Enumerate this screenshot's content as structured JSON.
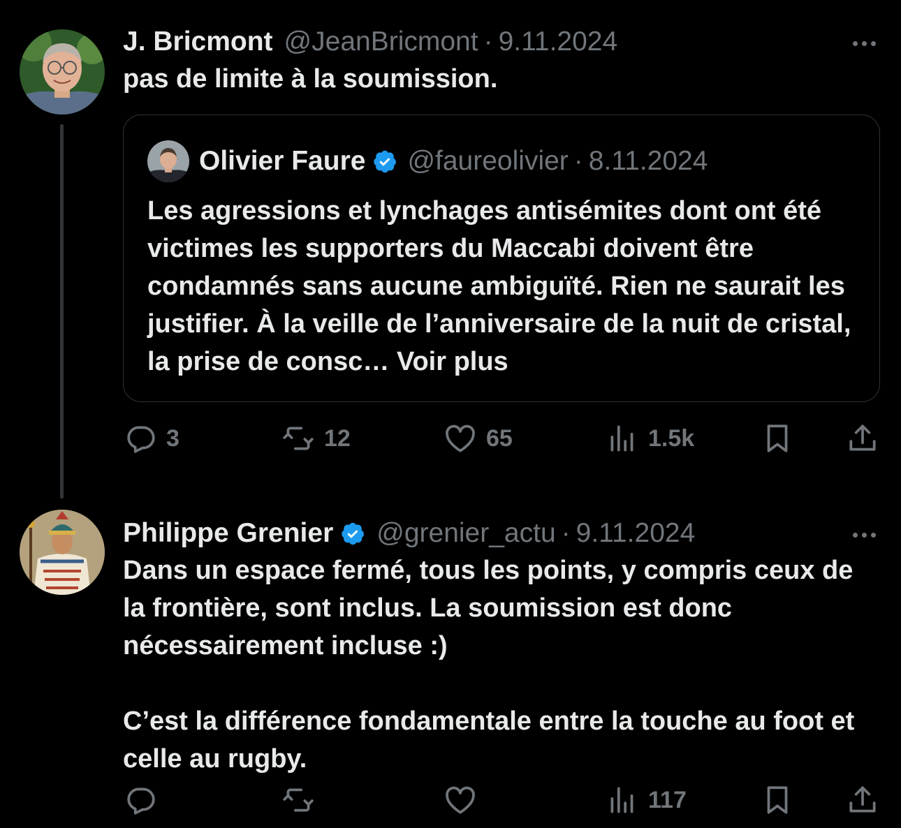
{
  "tweets": [
    {
      "name": "J. Bricmont",
      "handle": "@JeanBricmont",
      "separator": "·",
      "date": "9.11.2024",
      "text": "pas de limite à la soumission.",
      "quote": {
        "name": "Olivier Faure",
        "handle": "@faureolivier",
        "separator": "·",
        "date": "8.11.2024",
        "text": "Les agressions et lynchages antisémites dont ont été victimes les supporters du Maccabi doivent être condamnés sans aucune ambiguïté. Rien ne saurait les justifier. À la veille de l’anniversaire de la nuit de cristal, la prise de consc…",
        "see_more": "Voir plus"
      },
      "replies": "3",
      "retweets": "12",
      "likes": "65",
      "views": "1.5k"
    },
    {
      "name": "Philippe Grenier",
      "handle": "@grenier_actu",
      "separator": "·",
      "date": "9.11.2024",
      "text_p1": "Dans un espace fermé, tous les points, y compris ceux de la frontière, sont inclus. La soumission est donc nécessairement incluse :)",
      "text_p2": "C’est la différence fondamentale entre la touche au foot et celle au rugby.",
      "views": "117"
    }
  ],
  "icons": {
    "reply": "reply-icon",
    "retweet": "retweet-icon",
    "like": "heart-icon",
    "views": "views-icon",
    "bookmark": "bookmark-icon",
    "share": "share-icon",
    "verified": "verified-badge-icon",
    "more": "more-icon"
  },
  "colors": {
    "background": "#000000",
    "text": "#e7e9ea",
    "muted": "#71767b",
    "verified": "#1d9bf0",
    "border": "#2f3336"
  }
}
